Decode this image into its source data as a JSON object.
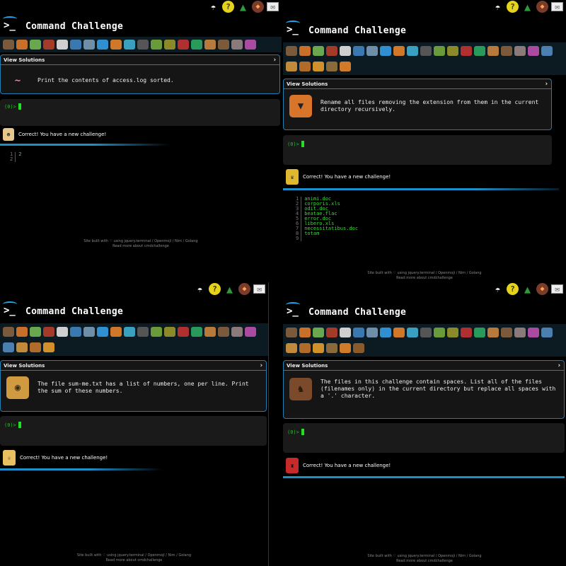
{
  "app": {
    "title": "Command Challenge",
    "logo_glyph": ">_",
    "view_solutions": "View Solutions",
    "chevron": "›",
    "prompt": "(0)>",
    "status_text": "Correct! You have a new challenge!",
    "footer_line1": "Site built with ♡ using jquery.terminal / Openmoji / Nim / Golang",
    "footer_line2": "Read more about cmdchallenge",
    "accent_color": "#1e90c8",
    "prompt_color": "#22c322",
    "top_icons": [
      "umbrella-icon",
      "lightbulb-icon",
      "tree-icon",
      "gitlab-fox-icon",
      "mail-icon"
    ]
  },
  "panels": [
    {
      "id": "q1",
      "challenge": "Print the contents of access.log sorted.",
      "avatar_icon": "worm-icon",
      "status_avatar_icon": "astronaut-icon",
      "badge_colors": [
        "#7a5a3a",
        "#c8702a",
        "#6aa84f",
        "#a33a2a",
        "#cfcfcf",
        "#3a78b0",
        "#6f8fa8",
        "#2f8fd0",
        "#d0782a",
        "#3aa0c0",
        "#555",
        "#6a9a3a",
        "#8a8a2a",
        "#b03030",
        "#2a9a5a",
        "#b87a3a",
        "#7a5a3a",
        "#8a7a7a",
        "#aa4aa0"
      ],
      "code_lines": [
        "2",
        ""
      ],
      "line_numbers": [
        "1",
        "2"
      ]
    },
    {
      "id": "q2",
      "challenge": "Rename all files removing the extension from them in the current directory recursively.",
      "avatar_icon": "tiger-icon",
      "status_avatar_icon": "queen-icon",
      "badge_colors": [
        "#7a5a3a",
        "#c8702a",
        "#6aa84f",
        "#a33a2a",
        "#cfcfcf",
        "#3a78b0",
        "#6f8fa8",
        "#2f8fd0",
        "#d0782a",
        "#3aa0c0",
        "#555",
        "#6a9a3a",
        "#8a8a2a",
        "#b03030",
        "#2a9a5a",
        "#b87a3a",
        "#7a5a3a",
        "#8a7a7a",
        "#aa4aa0",
        "#4a7fb0",
        "#c08a3a",
        "#b06a2a",
        "#d0902a",
        "#8a6a3a",
        "#d07a2a"
      ],
      "code_lines": [
        "animi.doc",
        "corporis.xls",
        "odit.doc",
        "beatae.flac",
        "error.doc",
        "libero.xls",
        "necessitatibus.doc",
        "totam",
        ""
      ],
      "line_numbers": [
        "1",
        "2",
        "3",
        "4",
        "5",
        "6",
        "7",
        "8",
        "9"
      ]
    },
    {
      "id": "q3",
      "challenge": "The file sum-me.txt has a list of numbers, one per line. Print the sum of these numbers.",
      "avatar_icon": "lion-icon",
      "status_avatar_icon": "princess-icon",
      "badge_colors": [
        "#7a5a3a",
        "#c8702a",
        "#6aa84f",
        "#a33a2a",
        "#cfcfcf",
        "#3a78b0",
        "#6f8fa8",
        "#2f8fd0",
        "#d0782a",
        "#3aa0c0",
        "#555",
        "#6a9a3a",
        "#8a8a2a",
        "#b03030",
        "#2a9a5a",
        "#b87a3a",
        "#7a5a3a",
        "#8a7a7a",
        "#aa4aa0",
        "#4a7fb0",
        "#c08a3a",
        "#b06a2a",
        "#d0902a"
      ],
      "code_lines": [],
      "line_numbers": []
    },
    {
      "id": "q4",
      "challenge": "The files in this challenge contain spaces. List all of the files (filenames only) in the current directory but replace all spaces with a '.' character.",
      "avatar_icon": "horse-icon",
      "status_avatar_icon": "guard-icon",
      "badge_colors": [
        "#7a5a3a",
        "#c8702a",
        "#6aa84f",
        "#a33a2a",
        "#cfcfcf",
        "#3a78b0",
        "#6f8fa8",
        "#2f8fd0",
        "#d0782a",
        "#3aa0c0",
        "#555",
        "#6a9a3a",
        "#8a8a2a",
        "#b03030",
        "#2a9a5a",
        "#b87a3a",
        "#7a5a3a",
        "#8a7a7a",
        "#aa4aa0",
        "#4a7fb0",
        "#c08a3a",
        "#b06a2a",
        "#d0902a",
        "#8a6a3a",
        "#d07a2a",
        "#8a5a2a"
      ],
      "code_lines": [],
      "line_numbers": []
    }
  ]
}
